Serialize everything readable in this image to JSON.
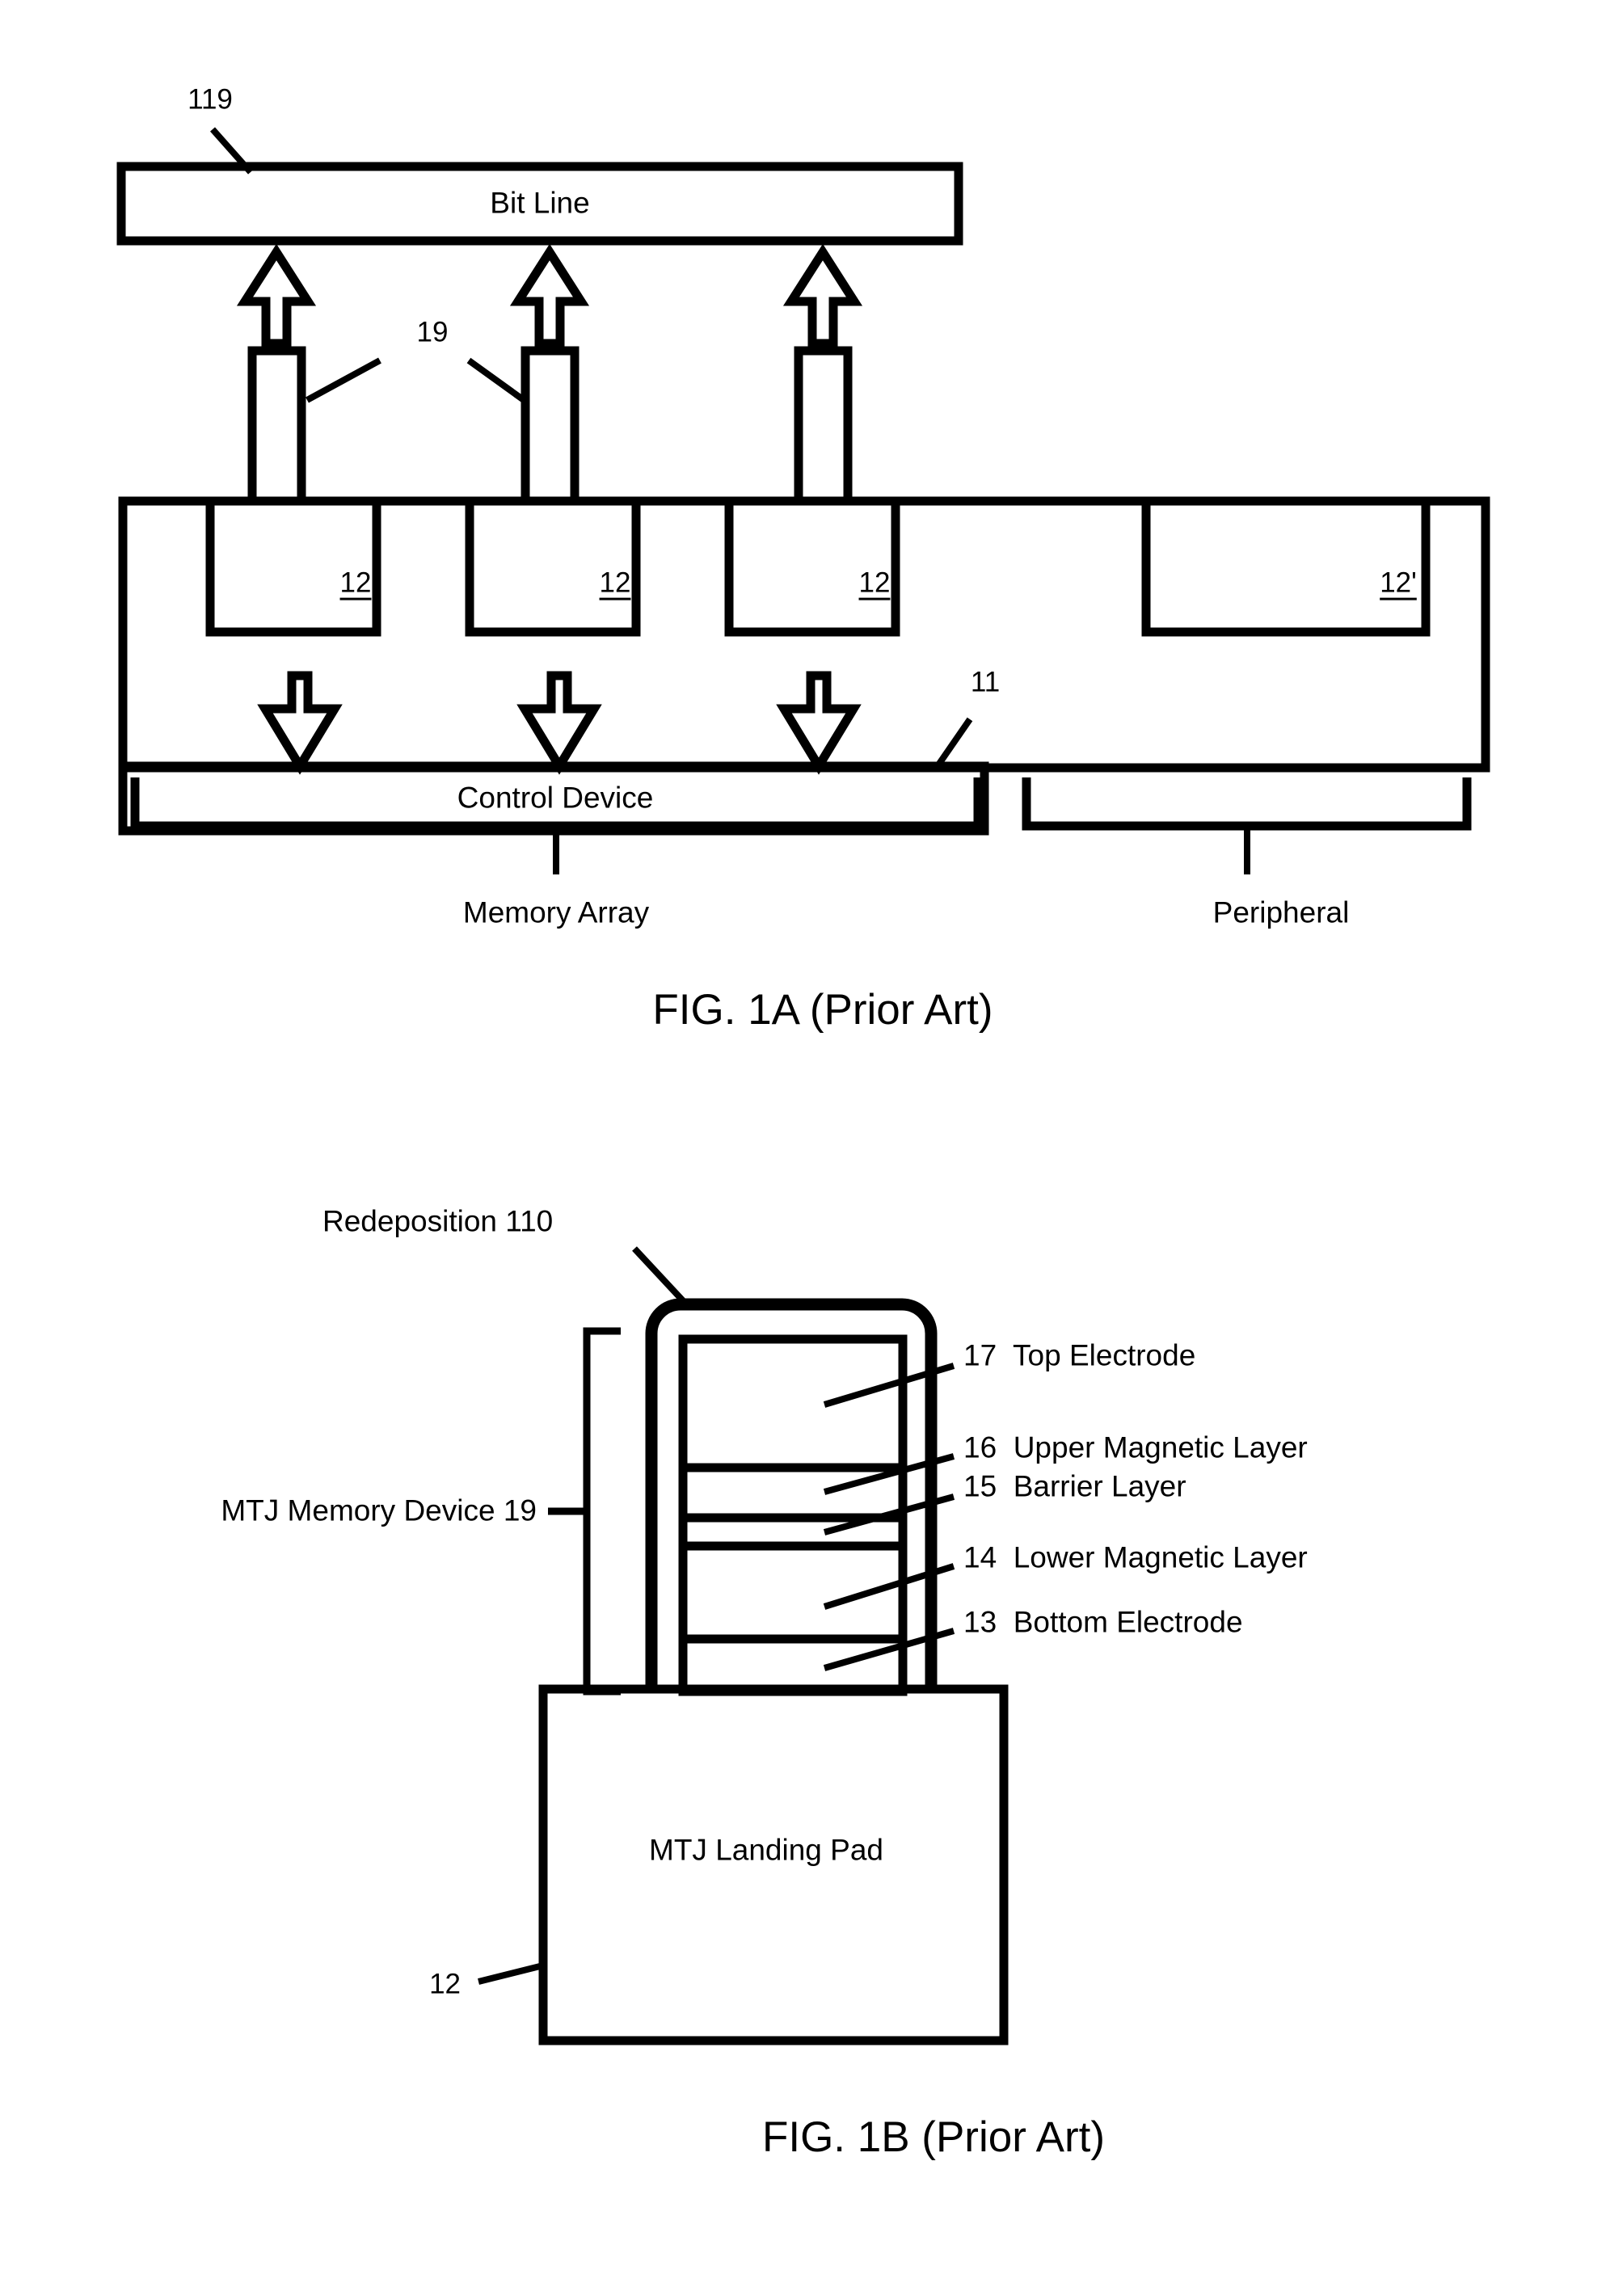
{
  "document": {
    "type": "patent-figure-sheet",
    "figures": [
      "FIG. 1A (Prior Art)",
      "FIG. 1B (Prior Art)"
    ]
  },
  "fig1a": {
    "caption": "FIG. 1A (Prior Art)",
    "bit_line_label": "Bit Line",
    "bit_line_ref": "119",
    "mtj_ref": "19",
    "landing_pad_refs": [
      "12",
      "12",
      "12"
    ],
    "peripheral_pad_ref": "12'",
    "control_device_label": "Control Device",
    "control_device_ref": "11",
    "region_left_label": "Memory Array",
    "region_right_label": "Peripheral"
  },
  "fig1b": {
    "caption": "FIG. 1B (Prior Art)",
    "redeposition_label": "Redeposition 110",
    "device_bracket_label": "MTJ Memory Device 19",
    "landing_pad_label": "MTJ Landing Pad",
    "landing_pad_ref": "12",
    "layers": [
      {
        "ref": "17",
        "name": "Top Electrode"
      },
      {
        "ref": "16",
        "name": "Upper Magnetic Layer"
      },
      {
        "ref": "15",
        "name": "Barrier Layer"
      },
      {
        "ref": "14",
        "name": "Lower Magnetic Layer"
      },
      {
        "ref": "13",
        "name": "Bottom Electrode"
      }
    ],
    "layer_callouts": [
      "17  Top Electrode",
      "16  Upper Magnetic Layer",
      "15  Barrier Layer",
      "14  Lower Magnetic Layer",
      "13  Bottom Electrode"
    ]
  },
  "style": {
    "ink": "#000000",
    "paper": "#ffffff"
  }
}
